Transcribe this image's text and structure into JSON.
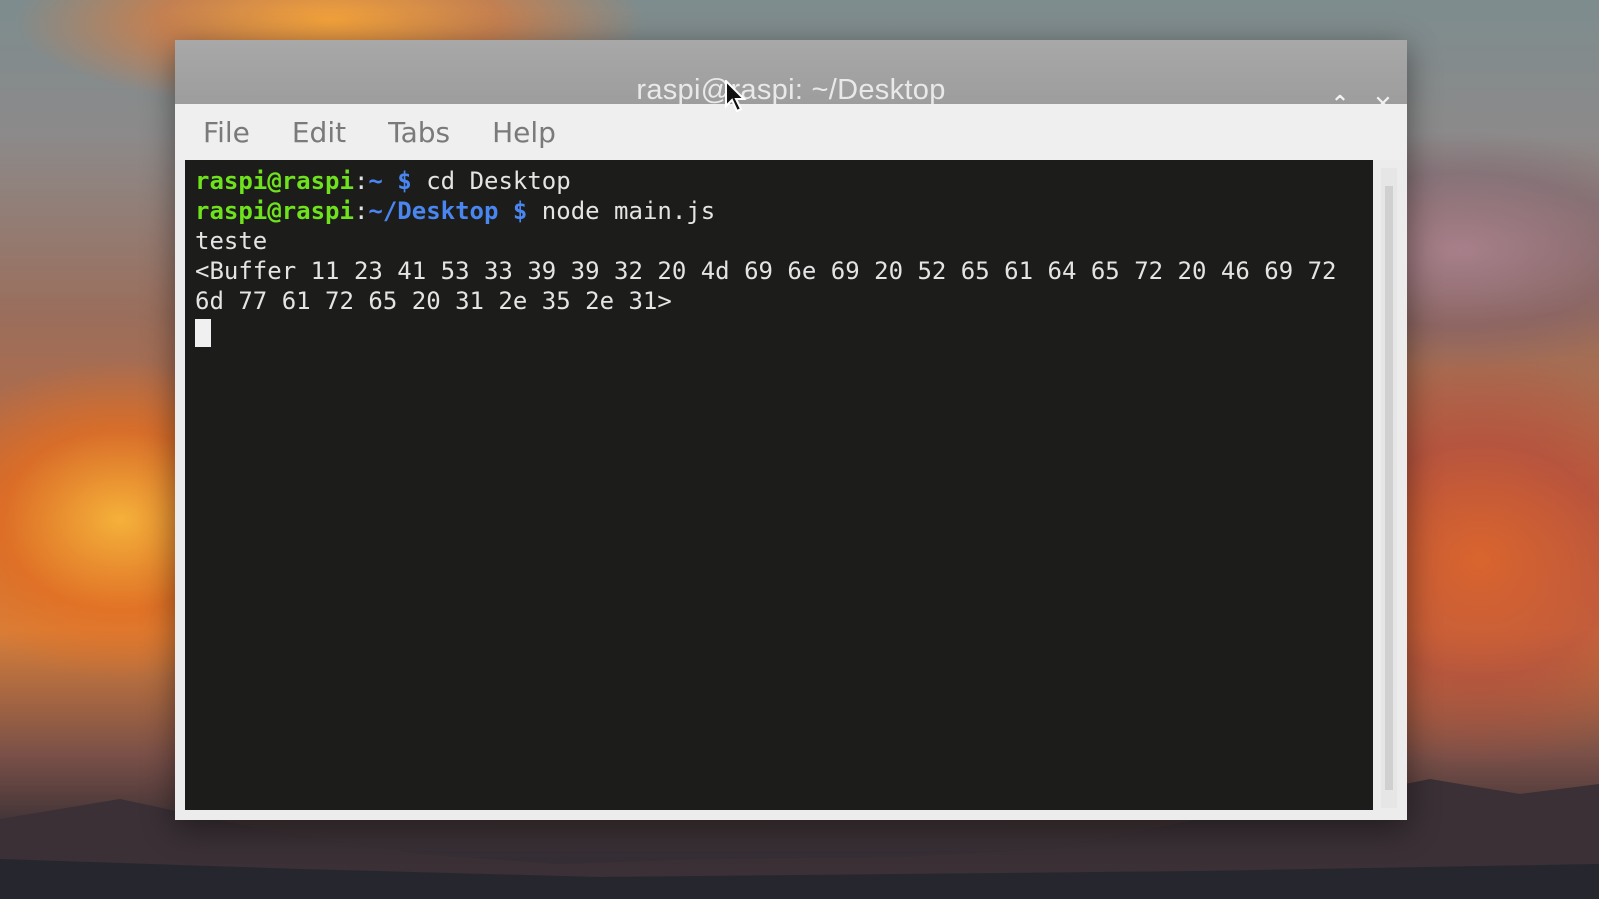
{
  "window": {
    "title": "raspi@raspi: ~/Desktop",
    "controls": {
      "minimize": "⌄",
      "maximize": "⌃",
      "close": "✕"
    }
  },
  "menu": [
    "File",
    "Edit",
    "Tabs",
    "Help"
  ],
  "terminal": {
    "lines": [
      {
        "user": "raspi@raspi",
        "sep": ":",
        "path": "~ $",
        "cmd": " cd Desktop"
      },
      {
        "user": "raspi@raspi",
        "sep": ":",
        "path": "~/Desktop $",
        "cmd": " node main.js"
      }
    ],
    "output": [
      "teste",
      "<Buffer 11 23 41 53 33 39 39 32 20 4d 69 6e 69 20 52 65 61 64 65 72 20 46 69 72",
      "6d 77 61 72 65 20 31 2e 35 2e 31>"
    ]
  },
  "colors": {
    "prompt_user": "#6ee21c",
    "prompt_path": "#4a86f0",
    "terminal_bg": "#1c1c1a",
    "terminal_fg": "#e4e4e4"
  }
}
